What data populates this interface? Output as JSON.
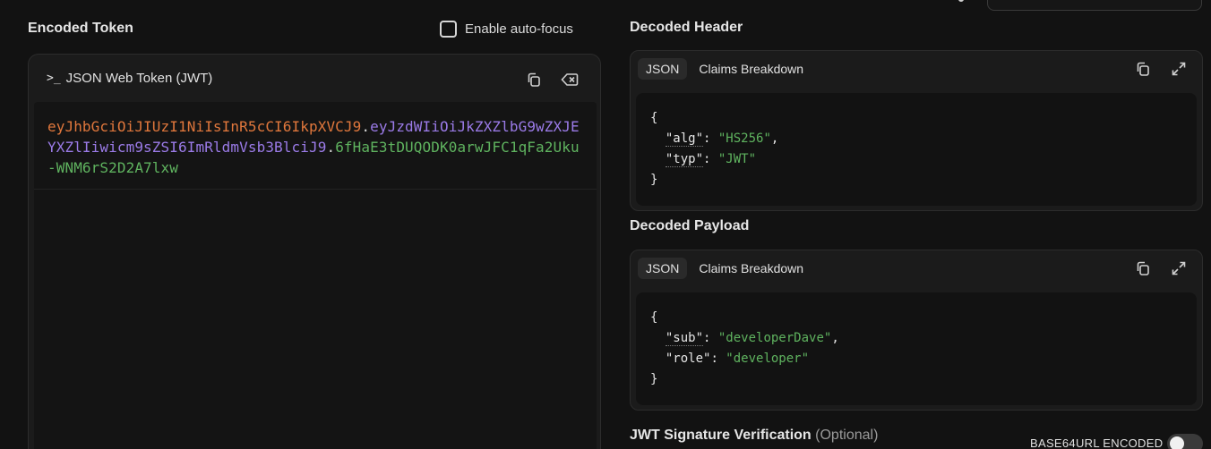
{
  "encoded": {
    "title": "Encoded Token",
    "autofocus_label": "Enable auto-focus",
    "card_title": "JSON Web Token (JWT)",
    "token_header": "eyJhbGciOiJIUzI1NiIsInR5cCI6IkpXVCJ9",
    "token_payload": "eyJzdWIiOiJkZXZlbG9wZXJEYXZlIiwicm9sZSI6ImRldmVsb3BlciJ9",
    "token_signature": "6fHaE3tDUQODK0arwJFC1qFa2Uku-WNM6rS2D2A7lxw",
    "separator": ".",
    "colors": {
      "header": "#e0773c",
      "payload": "#9b7be8",
      "signature": "#5fb35f"
    }
  },
  "header_section": {
    "title": "Decoded Header",
    "tabs": [
      "JSON",
      "Claims Breakdown"
    ],
    "open_brace": "{",
    "close_brace": "}",
    "claims": [
      {
        "key": "\"alg\"",
        "value": "\"HS256\"",
        "comma": ","
      },
      {
        "key": "\"typ\"",
        "value": "\"JWT\"",
        "comma": ""
      }
    ]
  },
  "payload_section": {
    "title": "Decoded Payload",
    "tabs": [
      "JSON",
      "Claims Breakdown"
    ],
    "open_brace": "{",
    "close_brace": "}",
    "claims": [
      {
        "key": "\"sub\"",
        "value": "\"developerDave\"",
        "comma": ","
      },
      {
        "key": "\"role\"",
        "value": "\"developer\"",
        "comma": ""
      }
    ]
  },
  "signature_section": {
    "title": "JWT Signature Verification",
    "optional_label": "(Optional)",
    "base64_label": "BASE64URL ENCODED",
    "base64_enabled": false
  },
  "icons": {
    "copy": "copy-icon",
    "clear": "clear-icon",
    "expand": "expand-icon",
    "prompt": "terminal-prompt-icon"
  }
}
